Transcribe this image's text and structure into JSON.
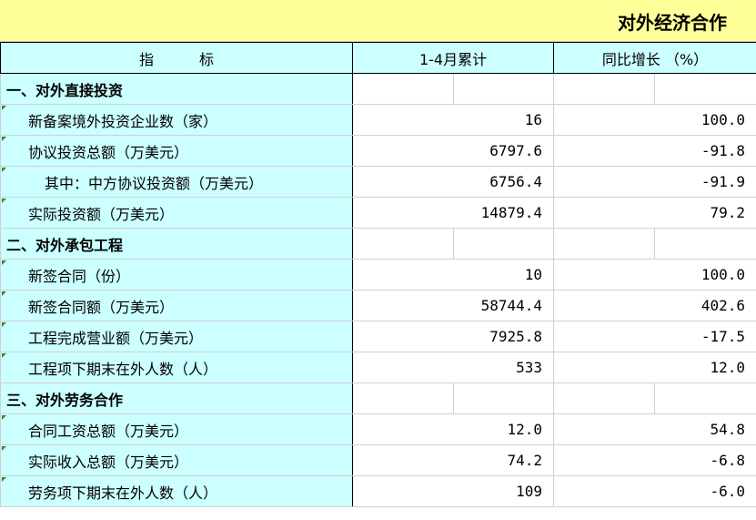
{
  "title": "对外经济合作",
  "header": {
    "indicator_left": "指",
    "indicator_right": "标",
    "cumulative": "1-4月累计",
    "yoy": "同比增长 （%）"
  },
  "sections": [
    {
      "label": "一、对外直接投资",
      "rows": [
        {
          "label": "新备案境外投资企业数（家）",
          "value": "16",
          "yoy": "100.0"
        },
        {
          "label": "协议投资总额（万美元）",
          "value": "6797.6",
          "yoy": "-91.8"
        },
        {
          "label": "其中：中方协议投资额（万美元）",
          "value": "6756.4",
          "yoy": "-91.9"
        },
        {
          "label": "实际投资额（万美元）",
          "value": "14879.4",
          "yoy": "79.2"
        }
      ]
    },
    {
      "label": "二、对外承包工程",
      "rows": [
        {
          "label": "新签合同（份）",
          "value": "10",
          "yoy": "100.0"
        },
        {
          "label": "新签合同额（万美元）",
          "value": "58744.4",
          "yoy": "402.6"
        },
        {
          "label": "工程完成营业额（万美元）",
          "value": "7925.8",
          "yoy": "-17.5"
        },
        {
          "label": "工程项下期末在外人数（人）",
          "value": "533",
          "yoy": "12.0"
        }
      ]
    },
    {
      "label": "三、对外劳务合作",
      "rows": [
        {
          "label": "合同工资总额（万美元）",
          "value": "12.0",
          "yoy": "54.8"
        },
        {
          "label": "实际收入总额（万美元）",
          "value": "74.2",
          "yoy": "-6.8"
        },
        {
          "label": "劳务项下期末在外人数（人）",
          "value": "109",
          "yoy": "-6.0"
        }
      ]
    }
  ]
}
